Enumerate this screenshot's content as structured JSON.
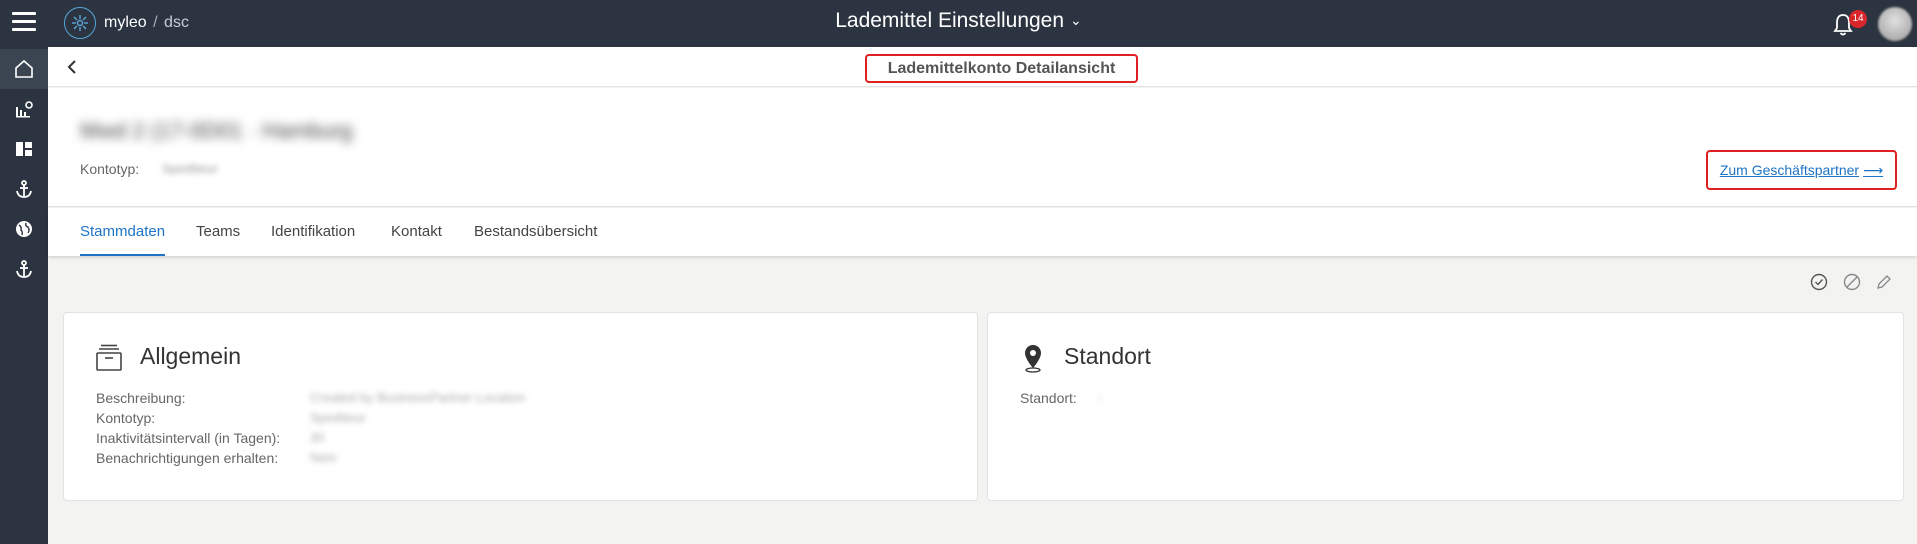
{
  "app": {
    "logo_name": "myleo",
    "logo_sep": "/",
    "logo_product": "dsc",
    "page_title": "Lademittel Einstellungen",
    "notification_count": "14"
  },
  "sidebar": {
    "icons": [
      "home-icon",
      "chart-settings-icon",
      "dashboard-icon",
      "anchor-icon",
      "globe-icon",
      "anchor-icon"
    ]
  },
  "subheader": {
    "title": "Lademittelkonto Detailansicht"
  },
  "account": {
    "name": "Mwd 2 (17-0D01 · Hamburg",
    "kontotyp_label": "Kontotyp:",
    "kontotyp_value": "Spediteur",
    "partner_link": "Zum Geschäftspartner"
  },
  "tabs": [
    {
      "label": "Stammdaten",
      "active": true
    },
    {
      "label": "Teams",
      "active": false
    },
    {
      "label": "Identifikation",
      "active": false
    },
    {
      "label": "Kontakt",
      "active": false
    },
    {
      "label": "Bestandsübersicht",
      "active": false
    }
  ],
  "allgemein": {
    "title": "Allgemein",
    "rows": [
      {
        "label": "Beschreibung:",
        "value": "Created by BusinessPartner Location"
      },
      {
        "label": "Kontotyp:",
        "value": "Spediteur"
      },
      {
        "label": "Inaktivitätsintervall (in Tagen):",
        "value": "30"
      },
      {
        "label": "Benachrichtigungen erhalten:",
        "value": "Nein"
      }
    ]
  },
  "standort": {
    "title": "Standort",
    "rows": [
      {
        "label": "Standort:",
        "value": "-"
      }
    ]
  },
  "colors": {
    "topbar": "#2b3440",
    "accent": "#1d74c4",
    "highlight": "#e02020"
  }
}
